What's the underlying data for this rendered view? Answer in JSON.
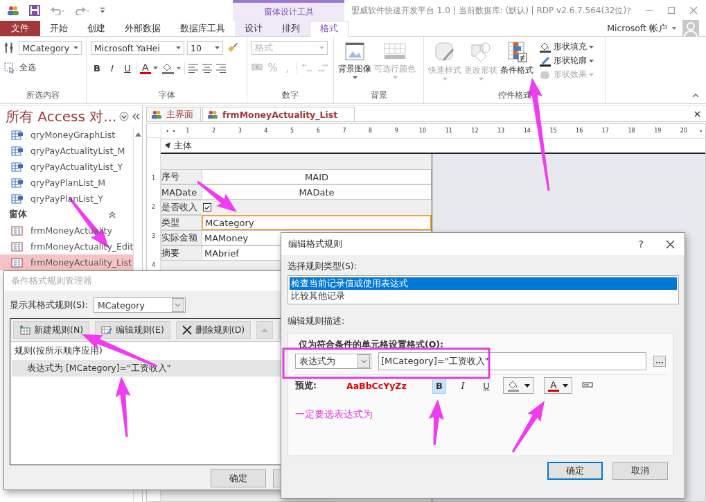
{
  "title_bar": {
    "context_group": "窗体设计工具",
    "title": "盟威软件快速开发平台 1.0 | 当前数据库: (默认) | RDP v2.6.7.564(32位)",
    "help": "?"
  },
  "ribbon_tabs": [
    {
      "label": "文件",
      "kind": "file",
      "selected": false
    },
    {
      "label": "开始",
      "kind": "normal",
      "selected": false
    },
    {
      "label": "创建",
      "kind": "normal",
      "selected": false
    },
    {
      "label": "外部数据",
      "kind": "normal",
      "selected": false
    },
    {
      "label": "数据库工具",
      "kind": "normal",
      "selected": false
    },
    {
      "label": "设计",
      "kind": "context",
      "selected": false
    },
    {
      "label": "排列",
      "kind": "context",
      "selected": false
    },
    {
      "label": "格式",
      "kind": "context",
      "selected": true
    }
  ],
  "account": "Microsoft 帐户",
  "ribbon": {
    "selection": {
      "label": "所选内容",
      "object": "MCategory",
      "select_all": "全选"
    },
    "font": {
      "label": "字体",
      "font_name": "Microsoft YaHei",
      "font_size": "10",
      "bold": "B",
      "italic": "I",
      "underline": "U",
      "font_color_glyph": "A"
    },
    "number": {
      "label": "数字",
      "format_placeholder": "格式",
      "percent": "%",
      "comma": ","
    },
    "background": {
      "label": "背景",
      "buttons": [
        {
          "kind": "background_image",
          "label": "背景图像",
          "disabled": false,
          "dropdown": true
        },
        {
          "kind": "alternate_row",
          "label": "可选行颜色",
          "disabled": true,
          "dropdown": true
        }
      ]
    },
    "control_format": {
      "label": "控件格式",
      "buttons": [
        {
          "kind": "quick_styles",
          "label": "快速样式",
          "disabled": true,
          "dropdown": true
        },
        {
          "kind": "change_shape",
          "label": "更改形状",
          "disabled": true,
          "dropdown": true
        },
        {
          "kind": "conditional",
          "label": "条件格式",
          "disabled": false,
          "dropdown": false
        }
      ],
      "menu": [
        {
          "kind": "fill",
          "label": "形状填充",
          "disabled": false
        },
        {
          "kind": "outline",
          "label": "形状轮廓",
          "disabled": false
        },
        {
          "kind": "effects",
          "label": "形状效果",
          "disabled": true
        }
      ]
    }
  },
  "nav": {
    "title": "所有 Access 对...",
    "items": [
      {
        "kind": "query",
        "label": "qryMoneyGraphList",
        "selected": false
      },
      {
        "kind": "query",
        "label": "qryPayActualityList_M",
        "selected": false
      },
      {
        "kind": "query",
        "label": "qryPayActualityList_Y",
        "selected": false
      },
      {
        "kind": "query",
        "label": "qryPayPlanList_M",
        "selected": false
      },
      {
        "kind": "query",
        "label": "qryPayPlanList_Y",
        "selected": false
      }
    ],
    "sections": [
      {
        "label": "窗体",
        "expanded": true,
        "children": [
          {
            "kind": "form",
            "label": "frmMoneyActuality",
            "selected": false
          },
          {
            "kind": "form",
            "label": "frmMoneyActuality_Edit",
            "selected": false
          },
          {
            "kind": "form",
            "label": "frmMoneyActuality_List",
            "selected": true
          }
        ]
      }
    ]
  },
  "doc_tabs": [
    {
      "label": "主界面",
      "selected": false
    },
    {
      "label": "frmMoneyActuality_List",
      "selected": true
    }
  ],
  "ruler_marks": [
    "1",
    "2",
    "3",
    "4",
    "5",
    "6",
    "7",
    "8",
    "9",
    "10",
    "11",
    "12",
    "13",
    "14",
    "15",
    "16",
    "17",
    "18",
    "19",
    "20"
  ],
  "vertical_ruler_marks": [
    "1",
    "2",
    "3",
    "4"
  ],
  "section_label": "主体",
  "form_rows": [
    {
      "kind": "centered_text",
      "label": "序号",
      "field": "MAID",
      "selected": false
    },
    {
      "kind": "centered_text",
      "label": "MADate",
      "field": "MADate",
      "selected": false
    },
    {
      "kind": "checkbox",
      "label": "是否收入",
      "checked": true,
      "selected": false
    },
    {
      "kind": "text",
      "label": "类型",
      "field": "MCategory",
      "selected": true
    },
    {
      "kind": "text",
      "label": "实际金额",
      "field": "MAMoney",
      "selected": false
    },
    {
      "kind": "text",
      "label": "摘要",
      "field": "MAbrief",
      "selected": false
    }
  ],
  "manager_dialog": {
    "title": "条件格式规则管理器",
    "show_label": "显示其格式规则(S):",
    "show_value": "MCategory",
    "toolbar": [
      {
        "kind": "new",
        "label": "新建规则(N)"
      },
      {
        "kind": "edit",
        "label": "编辑规则(E)"
      },
      {
        "kind": "delete",
        "label": "删除规则(D)"
      }
    ],
    "columns": [
      "规则(按所示顺序应用)"
    ],
    "rules": [
      {
        "text": "表达式为 [MCategory]=\"工资收入\"",
        "selected": true
      }
    ],
    "ok": "确定"
  },
  "edit_dialog": {
    "title": "编辑格式规则",
    "help": "?",
    "rule_type_label": "选择规则类型(S):",
    "rule_types": [
      {
        "label": "检查当前记录值或使用表达式",
        "selected": true
      },
      {
        "label": "比较其他记录",
        "selected": false
      }
    ],
    "description_label": "编辑规则描述:",
    "condition_label": "仅为符合条件的单元格设置格式(O):",
    "condition_type": "表达式为",
    "expression": "[MCategory]=\"工资收入\"",
    "builder": "...",
    "preview_label": "预览:",
    "preview_sample": "AaBbCcYyZz",
    "format_buttons": [
      {
        "kind": "bold",
        "label": "B",
        "on": true
      },
      {
        "kind": "italic",
        "label": "I",
        "on": false
      },
      {
        "kind": "underline",
        "label": "U",
        "on": false
      }
    ],
    "font_color_glyph": "A",
    "note": "一定要选表达式为",
    "ok": "确定",
    "cancel": "取消"
  }
}
